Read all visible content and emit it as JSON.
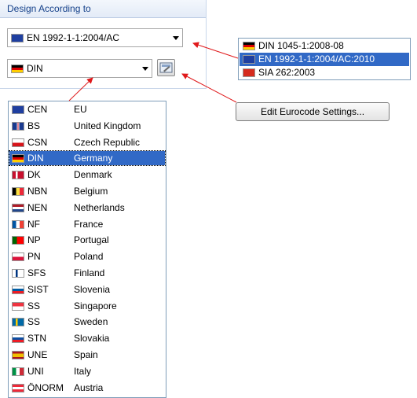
{
  "panel": {
    "title": "Design According to"
  },
  "combo_standard": {
    "value": "EN 1992-1-1:2004/AC",
    "flag": "eu"
  },
  "combo_annex": {
    "value": "DIN",
    "flag": "de"
  },
  "annex_list": [
    {
      "code": "CEN",
      "country": "EU",
      "flag": "eu"
    },
    {
      "code": "BS",
      "country": "United Kingdom",
      "flag": "gb"
    },
    {
      "code": "CSN",
      "country": "Czech Republic",
      "flag": "cz"
    },
    {
      "code": "DIN",
      "country": "Germany",
      "flag": "de",
      "selected": true
    },
    {
      "code": "DK",
      "country": "Denmark",
      "flag": "dk"
    },
    {
      "code": "NBN",
      "country": "Belgium",
      "flag": "be"
    },
    {
      "code": "NEN",
      "country": "Netherlands",
      "flag": "nl"
    },
    {
      "code": "NF",
      "country": "France",
      "flag": "fr"
    },
    {
      "code": "NP",
      "country": "Portugal",
      "flag": "pt"
    },
    {
      "code": "PN",
      "country": "Poland",
      "flag": "pl"
    },
    {
      "code": "SFS",
      "country": "Finland",
      "flag": "fi"
    },
    {
      "code": "SIST",
      "country": "Slovenia",
      "flag": "si"
    },
    {
      "code": "SS",
      "country": "Singapore",
      "flag": "sg"
    },
    {
      "code": "SS",
      "country": "Sweden",
      "flag": "se"
    },
    {
      "code": "STN",
      "country": "Slovakia",
      "flag": "sk"
    },
    {
      "code": "UNE",
      "country": "Spain",
      "flag": "es"
    },
    {
      "code": "UNI",
      "country": "Italy",
      "flag": "it"
    },
    {
      "code": "ÖNORM",
      "country": "Austria",
      "flag": "at"
    }
  ],
  "standard_menu": [
    {
      "label": "DIN 1045-1:2008-08",
      "flag": "de"
    },
    {
      "label": "EN 1992-1-1:2004/AC:2010",
      "flag": "eu",
      "selected": true
    },
    {
      "label": "SIA 262:2003",
      "flag": "ch"
    }
  ],
  "edit_button": {
    "label": "Edit Eurocode Settings..."
  },
  "colors": {
    "selection": "#3169c6",
    "arrow": "#e0191b",
    "panel_title": "#15418a"
  }
}
